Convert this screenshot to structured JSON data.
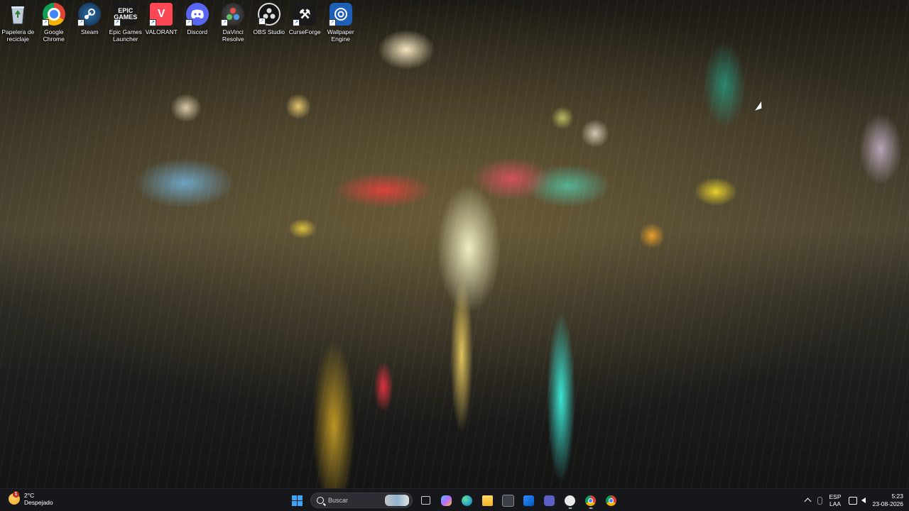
{
  "desktop": {
    "icons": [
      {
        "label": "Papelera de\nreciclaje",
        "icon": "recycle-bin-icon"
      },
      {
        "label": "Google\nChrome",
        "icon": "chrome-icon"
      },
      {
        "label": "Steam",
        "icon": "steam-icon"
      },
      {
        "label": "Epic Games\nLauncher",
        "icon": "epic-games-icon",
        "glyph": "EPIC\nGAMES"
      },
      {
        "label": "VALORANT",
        "icon": "valorant-icon",
        "glyph": "V"
      },
      {
        "label": "Discord",
        "icon": "discord-icon"
      },
      {
        "label": "DaVinci\nResolve",
        "icon": "davinci-resolve-icon"
      },
      {
        "label": "OBS Studio",
        "icon": "obs-studio-icon"
      },
      {
        "label": "CurseForge",
        "icon": "curseforge-icon",
        "glyph": "⚒"
      },
      {
        "label": "Wallpaper\nEngine",
        "icon": "wallpaper-engine-icon"
      }
    ]
  },
  "taskbar": {
    "weather": {
      "temp": "2°C",
      "desc": "Despejado",
      "badge": "1"
    },
    "search": {
      "label": "Buscar"
    },
    "apps": [
      {
        "name": "task-view-button",
        "icon": "task-view-icon"
      },
      {
        "name": "copilot-button",
        "icon": "copilot-icon"
      },
      {
        "name": "edge-button",
        "icon": "edge-icon"
      },
      {
        "name": "file-explorer-button",
        "icon": "folder-icon"
      },
      {
        "name": "store-button",
        "icon": "store-icon"
      },
      {
        "name": "mail-button",
        "icon": "mail-icon"
      },
      {
        "name": "teams-button",
        "icon": "teams-icon"
      },
      {
        "name": "github-button",
        "icon": "github-icon"
      },
      {
        "name": "chrome-taskbar-button",
        "icon": "chrome-icon"
      },
      {
        "name": "chrome-taskbar-button-2",
        "icon": "chrome-icon"
      }
    ],
    "tray": {
      "lang_top": "ESP",
      "lang_bottom": "LAA",
      "time": "5:23",
      "date": "23-08-2026"
    }
  }
}
